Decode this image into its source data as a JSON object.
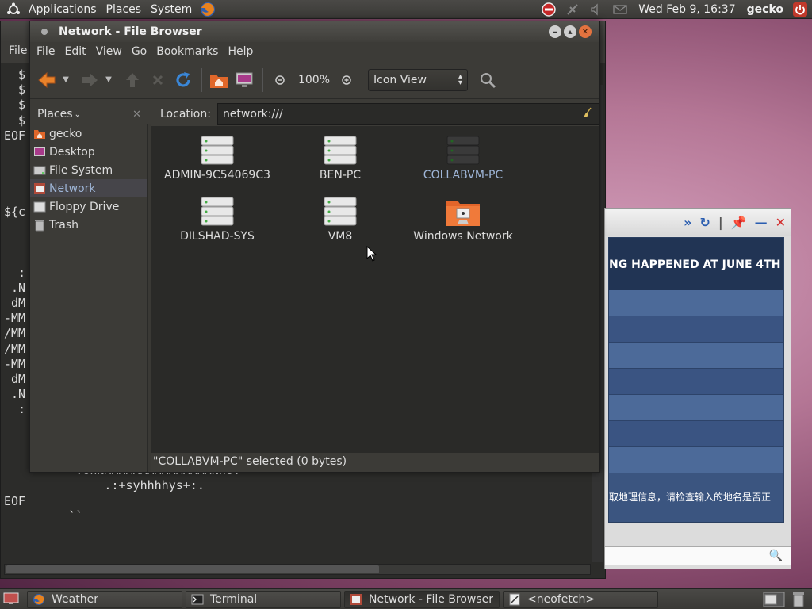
{
  "top_panel": {
    "menus": [
      "Applications",
      "Places",
      "System"
    ],
    "clock": "Wed Feb  9, 16:37",
    "username": "gecko"
  },
  "terminal": {
    "menu_first": "File",
    "text": "  $\n  $\n  $\n  $\nEOF\n\n\n\n\n${c\n\n\n\n  :\n .N\n dM\n-MM\n/MM\n/MM\n-MM\n dM\n .N\n  :\n    .hMMMMMMy`          NMMMMMMMMMMMMMm:\n      +NMMMMMms/.`     mMMMMMMMMMMMMN+\n       `+mMMMMMMMMNmddMMMMMMMMMMMm+`\n          .ohNMMMMMMMMMMMMMMMNho.\n              .:+syhhhhys+:.\nEOF\n         ``"
  },
  "browser": {
    "page_heading": "NG HAPPENED AT JUNE 4TH",
    "error_text": "取地理信息，请检查输入的地名是否正"
  },
  "file_browser": {
    "title": "Network - File Browser",
    "menus": [
      {
        "label": "File",
        "u": "F",
        "rest": "ile"
      },
      {
        "label": "Edit",
        "u": "E",
        "rest": "dit"
      },
      {
        "label": "View",
        "u": "V",
        "rest": "iew"
      },
      {
        "label": "Go",
        "u": "G",
        "rest": "o"
      },
      {
        "label": "Bookmarks",
        "u": "B",
        "rest": "ookmarks"
      },
      {
        "label": "Help",
        "u": "H",
        "rest": "elp"
      }
    ],
    "zoom_level": "100%",
    "view_mode": "Icon View",
    "places_label": "Places",
    "location_label": "Location:",
    "location_value": "network:///",
    "places": [
      {
        "label": "gecko",
        "icon": "home-folder-icon"
      },
      {
        "label": "Desktop",
        "icon": "desktop-icon"
      },
      {
        "label": "File System",
        "icon": "harddisk-icon"
      },
      {
        "label": "Network",
        "icon": "network-icon",
        "active": true
      },
      {
        "label": "Floppy Drive",
        "icon": "floppy-icon"
      },
      {
        "label": "Trash",
        "icon": "trash-icon"
      }
    ],
    "icons": [
      {
        "label": "ADMIN-9C54069C3",
        "icon": "server-icon"
      },
      {
        "label": "BEN-PC",
        "icon": "server-icon"
      },
      {
        "label": "COLLABVM-PC",
        "icon": "server-icon",
        "selected": true
      },
      {
        "label": "DILSHAD-SYS",
        "icon": "server-icon"
      },
      {
        "label": "VM8",
        "icon": "server-icon"
      },
      {
        "label": "Windows Network",
        "icon": "windows-network-folder-icon"
      }
    ],
    "status": "\"COLLABVM-PC\" selected (0 bytes)"
  },
  "taskbar": {
    "tasks": [
      {
        "label": "Weather",
        "icon": "firefox-icon"
      },
      {
        "label": "Terminal",
        "icon": "terminal-icon"
      },
      {
        "label": "Network - File Browser",
        "icon": "file-browser-icon",
        "active": true
      },
      {
        "label": "<neofetch>",
        "icon": "text-editor-icon"
      }
    ]
  },
  "colors": {
    "panel": "#3c3b37",
    "selection_text": "#9fb6d8",
    "close_button": "#e3733f",
    "desktop": "#b47695"
  }
}
